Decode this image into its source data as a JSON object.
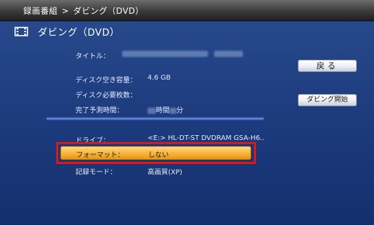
{
  "header": {
    "breadcrumb_root": "録画番組",
    "breadcrumb_sep": ">",
    "breadcrumb_current": "ダビング（DVD）"
  },
  "page": {
    "title": "ダビング（DVD）",
    "title_icon": "film-icon"
  },
  "fields": {
    "title_label": "タイトル：",
    "free_space_label": "ディスク空き容量：",
    "free_space_value": "4.6 GB",
    "discs_needed_label": "ディスク必要枚数：",
    "eta_label": "完了予測時間：",
    "eta_hours_unit": "時間",
    "eta_minutes_unit": "分"
  },
  "options": {
    "drive_label": "ドライブ：",
    "drive_value": "<E:> HL-DT-ST DVDRAM GSA-H6..",
    "format_label": "フォーマット：",
    "format_value": "しない",
    "record_mode_label": "記録モード：",
    "record_mode_value": "高画質(XP)"
  },
  "buttons": {
    "back_label": "戻る",
    "start_label": "ダビング開始"
  },
  "colors": {
    "background": "#1f3f82",
    "highlight": "#f7b33a",
    "annotation_frame": "#e11717",
    "divider": "#5e86dc"
  }
}
